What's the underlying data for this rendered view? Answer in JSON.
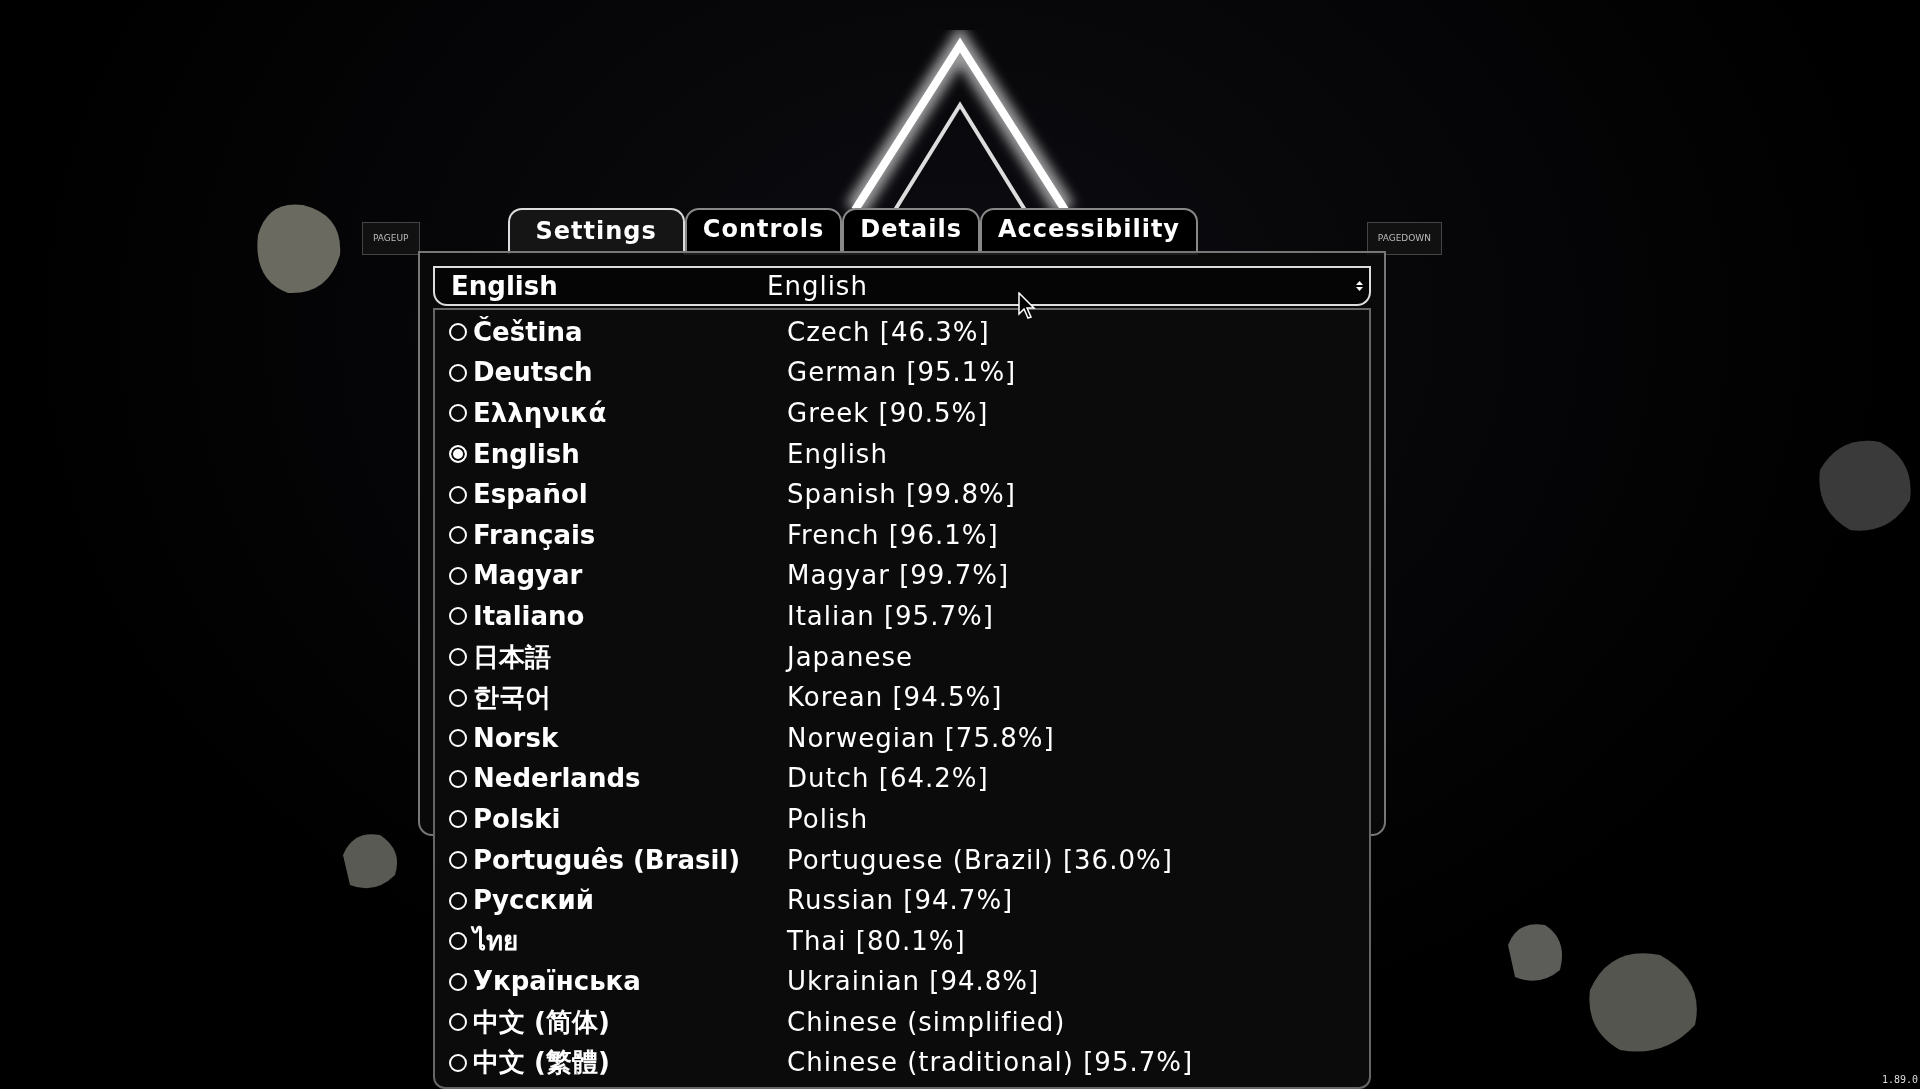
{
  "page_up": "PAGEUP",
  "tabs": [
    {
      "label": "Settings",
      "selected": true
    },
    {
      "label": "Controls",
      "selected": false
    },
    {
      "label": "Details",
      "selected": false
    },
    {
      "label": "Accessibility",
      "selected": false
    }
  ],
  "page_down": "PAGEDOWN",
  "language_select": {
    "native": "English",
    "name": "English"
  },
  "languages": [
    {
      "native": "Čeština",
      "name": "Czech [46.3%]",
      "selected": false
    },
    {
      "native": "Deutsch",
      "name": "German [95.1%]",
      "selected": false
    },
    {
      "native": "Ελληνικά",
      "name": "Greek [90.5%]",
      "selected": false
    },
    {
      "native": "English",
      "name": "English",
      "selected": true
    },
    {
      "native": "Español",
      "name": "Spanish [99.8%]",
      "selected": false
    },
    {
      "native": "Français",
      "name": "French [96.1%]",
      "selected": false
    },
    {
      "native": "Magyar",
      "name": "Magyar [99.7%]",
      "selected": false
    },
    {
      "native": "Italiano",
      "name": "Italian [95.7%]",
      "selected": false
    },
    {
      "native": "日本語",
      "name": "Japanese",
      "selected": false
    },
    {
      "native": "한국어",
      "name": "Korean [94.5%]",
      "selected": false
    },
    {
      "native": "Norsk",
      "name": "Norwegian [75.8%]",
      "selected": false
    },
    {
      "native": "Nederlands",
      "name": "Dutch [64.2%]",
      "selected": false
    },
    {
      "native": "Polski",
      "name": "Polish",
      "selected": false
    },
    {
      "native": "Português (Brasil)",
      "name": "Portuguese (Brazil) [36.0%]",
      "selected": false
    },
    {
      "native": "Русский",
      "name": "Russian [94.7%]",
      "selected": false
    },
    {
      "native": "ไทย",
      "name": "Thai [80.1%]",
      "selected": false
    },
    {
      "native": "Українська",
      "name": "Ukrainian [94.8%]",
      "selected": false
    },
    {
      "native": "中文 (简体)",
      "name": "Chinese (simplified)",
      "selected": false
    },
    {
      "native": "中文 (繁體)",
      "name": "Chinese (traditional) [95.7%]",
      "selected": false
    }
  ],
  "version": "1.89.0"
}
